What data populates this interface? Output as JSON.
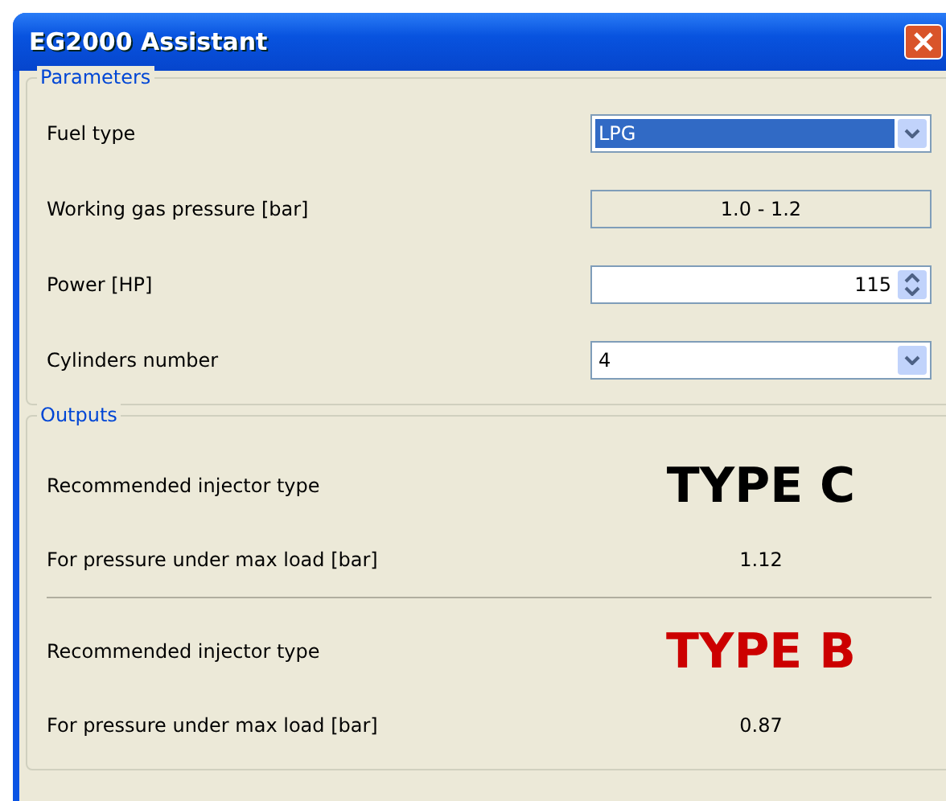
{
  "window": {
    "title": "EG2000 Assistant"
  },
  "parameters": {
    "title": "Parameters",
    "rows": [
      {
        "label": "Fuel type",
        "kind": "dropdown",
        "value": "LPG",
        "selected": true
      },
      {
        "label": "Working gas pressure [bar]",
        "kind": "readonly",
        "value": "1.0 - 1.2"
      },
      {
        "label": "Power [HP]",
        "kind": "spinner",
        "value": "115"
      },
      {
        "label": "Cylinders number",
        "kind": "dropdown",
        "value": "4",
        "selected": false
      }
    ]
  },
  "outputs": {
    "title": "Outputs",
    "results": [
      {
        "type_label": "Recommended injector type",
        "type": "TYPE C",
        "color": "#000000",
        "pressure_label": "For pressure under max load [bar]",
        "pressure": "1.12"
      },
      {
        "type_label": "Recommended injector type",
        "type": "TYPE B",
        "color": "#cc0000",
        "pressure_label": "For pressure under max load [bar]",
        "pressure": "0.87"
      }
    ]
  }
}
